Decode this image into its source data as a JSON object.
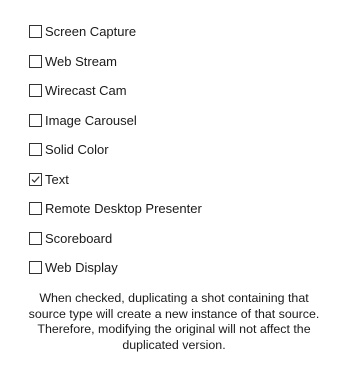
{
  "source_types": [
    {
      "label": "Screen Capture",
      "checked": false
    },
    {
      "label": "Web Stream",
      "checked": false
    },
    {
      "label": "Wirecast Cam",
      "checked": false
    },
    {
      "label": "Image Carousel",
      "checked": false
    },
    {
      "label": "Solid Color",
      "checked": false
    },
    {
      "label": "Text",
      "checked": true
    },
    {
      "label": "Remote Desktop Presenter",
      "checked": false
    },
    {
      "label": "Scoreboard",
      "checked": false
    },
    {
      "label": "Web Display",
      "checked": false
    }
  ],
  "description": "When checked, duplicating a shot containing that source type will create a new instance of that source. Therefore, modifying the original will not affect the duplicated version.",
  "colors": {
    "checkbox_border": "#333333",
    "check_mark": "#333333",
    "text": "#1a1a1a",
    "background": "#ffffff"
  }
}
